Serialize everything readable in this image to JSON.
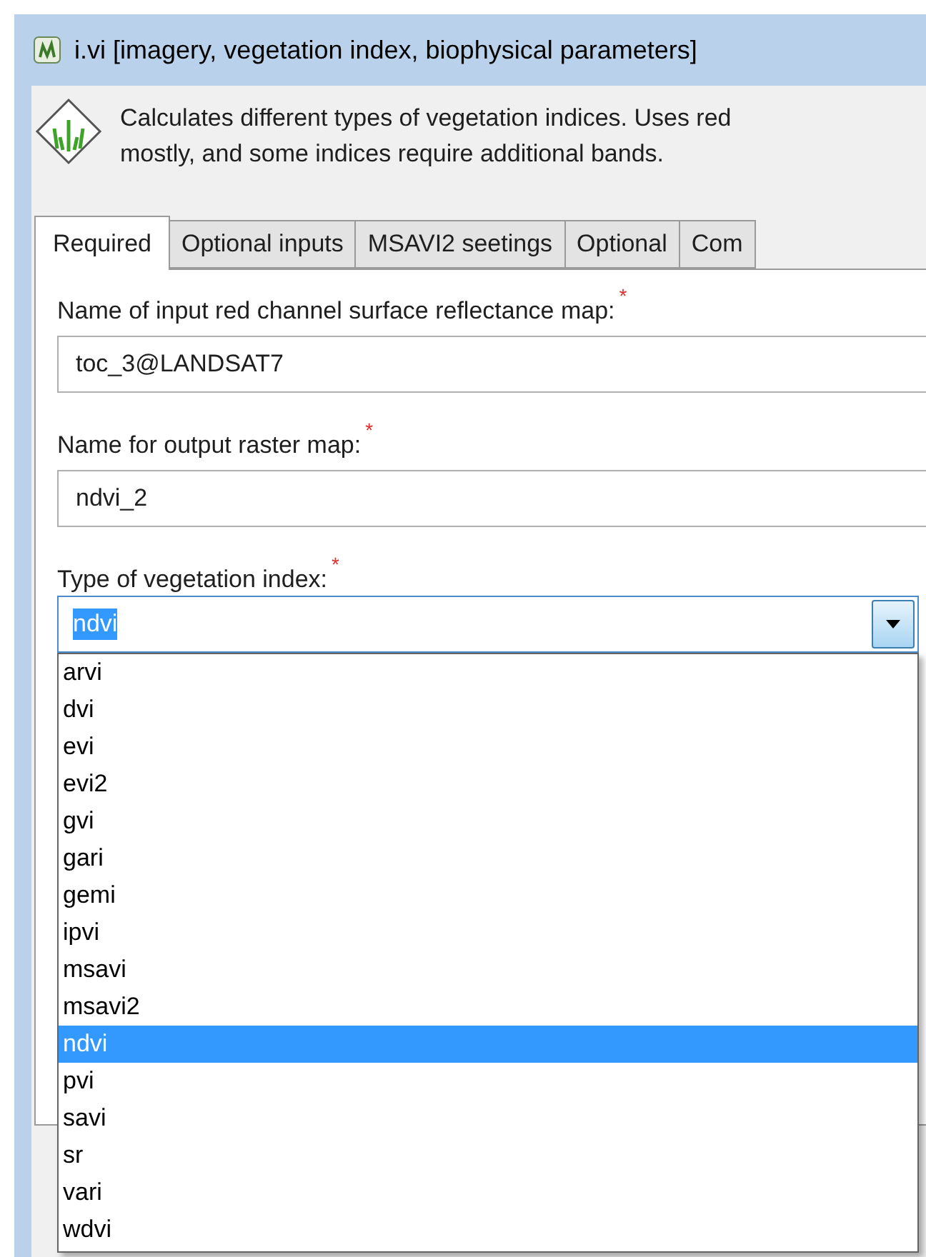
{
  "window": {
    "title": "i.vi [imagery, vegetation index, biophysical parameters]"
  },
  "description": "Calculates different types of vegetation indices. Uses red\nmostly, and some indices require additional bands.",
  "tabs": [
    {
      "label": "Required",
      "selected": true
    },
    {
      "label": "Optional inputs",
      "selected": false
    },
    {
      "label": "MSAVI2 seetings",
      "selected": false
    },
    {
      "label": "Optional",
      "selected": false
    },
    {
      "label": "Com",
      "selected": false
    }
  ],
  "fields": [
    {
      "label": "Name of input red channel surface reflectance map:",
      "required_mark": "*",
      "value": "toc_3@LANDSAT7"
    },
    {
      "label": "Name for output raster map:",
      "required_mark": "*",
      "value": "ndvi_2"
    }
  ],
  "combo": {
    "label": "Type of vegetation index:",
    "required_mark": "*",
    "value": "ndvi",
    "expanded": true,
    "options": [
      {
        "label": "arvi",
        "selected": false
      },
      {
        "label": "dvi",
        "selected": false
      },
      {
        "label": "evi",
        "selected": false
      },
      {
        "label": "evi2",
        "selected": false
      },
      {
        "label": "gvi",
        "selected": false
      },
      {
        "label": "gari",
        "selected": false
      },
      {
        "label": "gemi",
        "selected": false
      },
      {
        "label": "ipvi",
        "selected": false
      },
      {
        "label": "msavi",
        "selected": false
      },
      {
        "label": "msavi2",
        "selected": false
      },
      {
        "label": "ndvi",
        "selected": true
      },
      {
        "label": "pvi",
        "selected": false
      },
      {
        "label": "savi",
        "selected": false
      },
      {
        "label": "sr",
        "selected": false
      },
      {
        "label": "vari",
        "selected": false
      },
      {
        "label": "wdvi",
        "selected": false
      }
    ]
  }
}
